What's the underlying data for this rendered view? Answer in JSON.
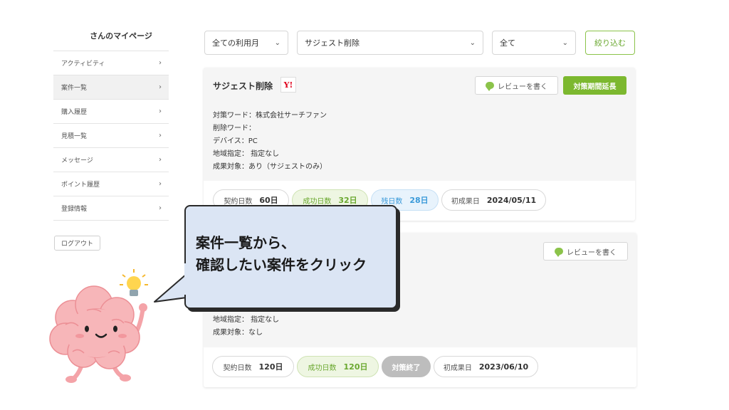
{
  "sidebar": {
    "title": "さんのマイページ",
    "items": [
      {
        "label": "アクティビティ",
        "active": false
      },
      {
        "label": "案件一覧",
        "active": true
      },
      {
        "label": "購入履歴",
        "active": false
      },
      {
        "label": "見積一覧",
        "active": false
      },
      {
        "label": "メッセージ",
        "active": false
      },
      {
        "label": "ポイント履歴",
        "active": false
      },
      {
        "label": "登録情報",
        "active": false
      }
    ],
    "logout_label": "ログアウト"
  },
  "filters": {
    "month": "全ての利用月",
    "service": "サジェスト削除",
    "status": "全て",
    "narrow_label": "絞り込む"
  },
  "cards": [
    {
      "title": "サジェスト削除",
      "engine_icon": "yahoo-logo",
      "engine_text": "Y!",
      "review_label": "レビューを書く",
      "extend_label": "対策期間延長",
      "details": [
        "対策ワード：株式会社サーチファン",
        "削除ワード：",
        "デバイス：PC",
        "地域指定： 指定なし",
        "成果対象：あり（サジェストのみ）"
      ],
      "stats": {
        "contract_label": "契約日数",
        "contract_value": "60日",
        "success_label": "成功日数",
        "success_value": "32日",
        "remaining_label": "残日数",
        "remaining_value": "28日",
        "first_label": "初成果日",
        "first_value": "2024/05/11"
      }
    },
    {
      "review_label": "レビューを書く",
      "details_visible": [
        "地域指定： 指定なし",
        "成果対象：なし"
      ],
      "stats": {
        "contract_label": "契約日数",
        "contract_value": "120日",
        "success_label": "成功日数",
        "success_value": "120日",
        "ended_label": "対策終了",
        "first_label": "初成果日",
        "first_value": "2023/06/10"
      }
    }
  ],
  "callout": {
    "line1": "案件一覧から、",
    "line2": "確認したい案件をクリック"
  },
  "colors": {
    "accent_green": "#7cb82f",
    "remaining_blue": "#3a9ad9",
    "callout_bg": "#dbe5f4"
  }
}
